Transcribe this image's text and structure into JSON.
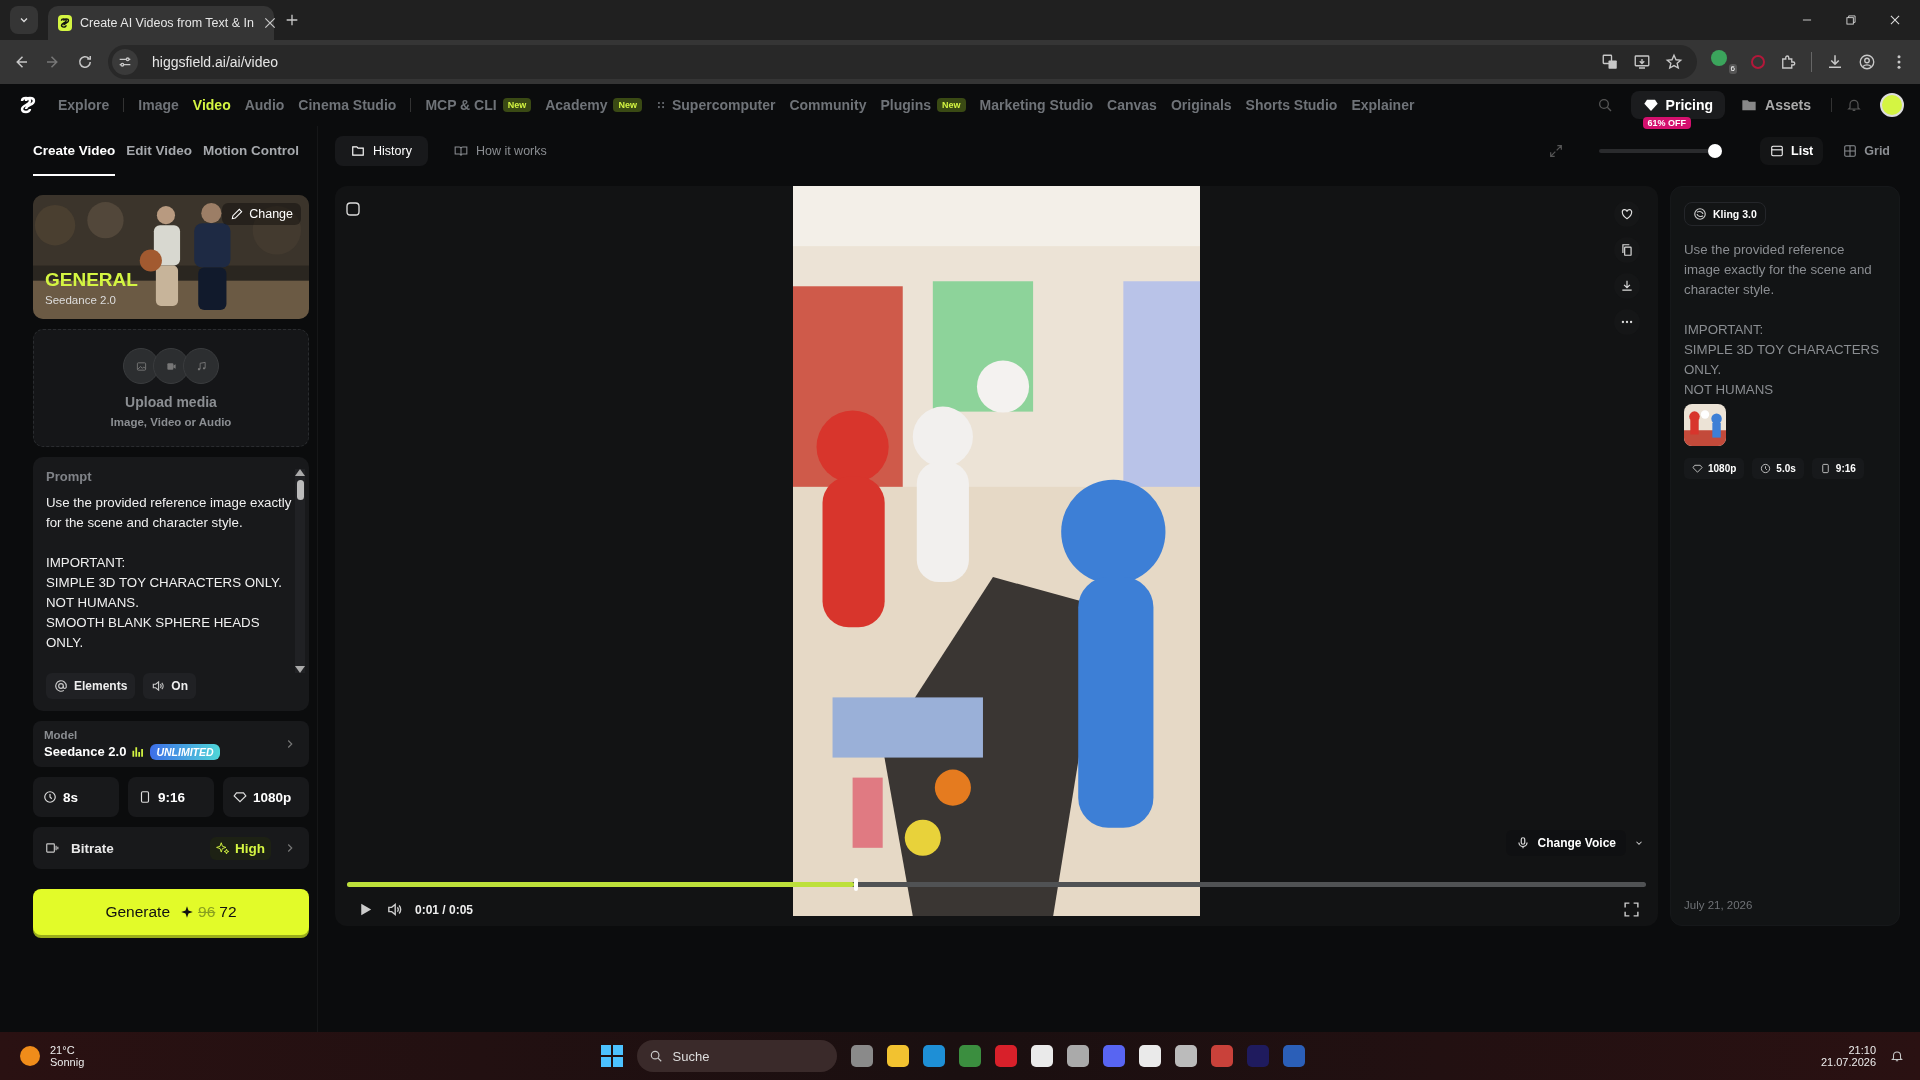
{
  "browser": {
    "tab_title": "Create AI Videos from Text & In",
    "url": "higgsfield.ai/ai/video",
    "extension_badge": "6"
  },
  "nav": {
    "items": [
      {
        "label": "Explore",
        "selected": false,
        "divider_after": true
      },
      {
        "label": "Image",
        "selected": false
      },
      {
        "label": "Video",
        "selected": true
      },
      {
        "label": "Audio",
        "selected": false
      },
      {
        "label": "Cinema Studio",
        "selected": false,
        "divider_after": true
      },
      {
        "label": "MCP & CLI",
        "selected": false,
        "badge": "New"
      },
      {
        "label": "Academy",
        "selected": false,
        "badge": "New"
      },
      {
        "label": "Supercomputer",
        "selected": false,
        "kind": "dotted"
      },
      {
        "label": "Community",
        "selected": false
      },
      {
        "label": "Plugins",
        "selected": false,
        "badge": "New"
      },
      {
        "label": "Marketing Studio",
        "selected": false
      },
      {
        "label": "Canvas",
        "selected": false
      },
      {
        "label": "Originals",
        "selected": false
      },
      {
        "label": "Shorts Studio",
        "selected": false
      },
      {
        "label": "Explainer",
        "selected": false
      }
    ],
    "pricing": "Pricing",
    "pricing_badge": "61% OFF",
    "assets": "Assets"
  },
  "left": {
    "tabs": [
      {
        "label": "Create Video",
        "selected": true
      },
      {
        "label": "Edit Video",
        "selected": false
      },
      {
        "label": "Motion Control",
        "selected": false
      }
    ],
    "preset": {
      "title": "GENERAL",
      "subtitle": "Seedance 2.0",
      "change": "Change"
    },
    "upload": {
      "title": "Upload media",
      "subtitle": "Image, Video or Audio"
    },
    "prompt": {
      "label": "Prompt",
      "text": "Use the provided reference image exactly for the scene and character style.\n\nIMPORTANT:\nSIMPLE 3D TOY CHARACTERS ONLY.\nNOT HUMANS.\nSMOOTH BLANK SPHERE HEADS ONLY."
    },
    "chips": [
      {
        "kind": "elements",
        "label": "Elements"
      },
      {
        "kind": "sound",
        "label": "On"
      }
    ],
    "model": {
      "label": "Model",
      "name": "Seedance 2.0",
      "badge": "UNLIMITED"
    },
    "settings": [
      {
        "kind": "duration",
        "label": "8s"
      },
      {
        "kind": "ratio",
        "label": "9:16"
      },
      {
        "kind": "quality",
        "label": "1080p"
      }
    ],
    "bitrate": {
      "label": "Bitrate",
      "value": "High"
    },
    "generate": {
      "label": "Generate",
      "old_cost": "96",
      "cost": "72"
    }
  },
  "center": {
    "tabs": [
      {
        "label": "History",
        "selected": true
      },
      {
        "label": "How it works",
        "selected": false
      }
    ],
    "select_all": {
      "checked": false
    },
    "size_slider": {
      "level": 0.97
    },
    "views": [
      {
        "label": "List",
        "kind": "list",
        "selected": true
      },
      {
        "label": "Grid",
        "kind": "grid",
        "selected": false
      }
    ],
    "player": {
      "progress": {
        "level": 0.39
      },
      "time": "0:01 / 0:05",
      "change_voice": "Change Voice"
    }
  },
  "details": {
    "model": "Kling 3.0",
    "prompt": "Use the provided reference image exactly for the scene and character style.\n\nIMPORTANT:\nSIMPLE 3D TOY CHARACTERS ONLY.\nNOT HUMANS",
    "tags": [
      {
        "kind": "quality",
        "label": "1080p"
      },
      {
        "kind": "duration",
        "label": "5.0s"
      },
      {
        "kind": "ratio",
        "label": "9:16"
      }
    ],
    "date": "July 21, 2026"
  },
  "taskbar": {
    "temperature": "21°C",
    "weather": "Sonnig",
    "search": "Suche",
    "time": "21:10",
    "date": "21.07.2026"
  }
}
